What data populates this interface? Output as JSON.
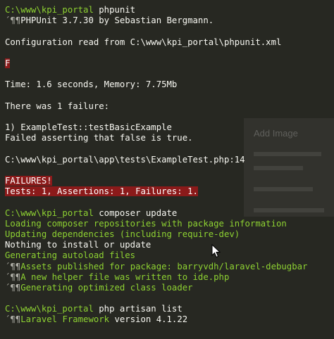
{
  "prompt_path": "C:\\www\\kpi_portal",
  "commands": {
    "phpunit": "phpunit",
    "composer": "composer update",
    "artisan": "php artisan list"
  },
  "glyph": "´¶¶",
  "phpunit_output": {
    "version": "PHPUnit 3.7.30 by Sebastian Bergmann.",
    "config": "Configuration read from C:\\www\\kpi_portal\\phpunit.xml",
    "progress": "F",
    "time": "Time: 1.6 seconds, Memory: 7.75Mb",
    "failure_count": "There was 1 failure:",
    "failure_test": "1) ExampleTest::testBasicExample",
    "failure_msg": "Failed asserting that false is true.",
    "failure_file": "C:\\www\\kpi_portal\\app\\tests\\ExampleTest.php:14",
    "failures_label": "FAILURES!",
    "summary": "Tests: 1, Assertions: 1, Failures: 1."
  },
  "composer_output": {
    "loading": "Loading composer repositories with package information",
    "updating": "Updating dependencies (including require-dev)",
    "nothing": "Nothing to install or update",
    "autoload": "Generating autoload files",
    "assets": "Assets published for package: barryvdh/laravel-debugbar",
    "helper": "A new helper file was written to ide.php",
    "optimized": "Generating optimized class loader"
  },
  "artisan_output": {
    "framework": "Laravel Framework",
    "version": "version 4.1.22"
  },
  "ghost_dialog": {
    "title": "Add Image"
  },
  "colors": {
    "background": "#272822",
    "text": "#f8f8f2",
    "green": "#8ed232",
    "failure_bg": "#8b1a1a"
  }
}
